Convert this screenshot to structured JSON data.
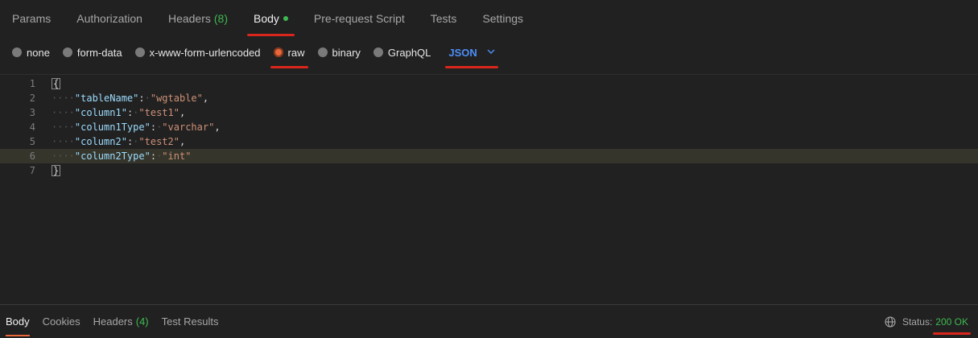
{
  "request_tabs": {
    "params": "Params",
    "authorization": "Authorization",
    "headers": "Headers",
    "headers_count": "(8)",
    "body": "Body",
    "pre_request": "Pre-request Script",
    "tests": "Tests",
    "settings": "Settings"
  },
  "body_options": {
    "none": "none",
    "form_data": "form-data",
    "urlencoded": "x-www-form-urlencoded",
    "raw": "raw",
    "binary": "binary",
    "graphql": "GraphQL",
    "selected": "raw",
    "language": "JSON"
  },
  "editor": {
    "line_numbers": [
      "1",
      "2",
      "3",
      "4",
      "5",
      "6",
      "7"
    ],
    "open_brace": "{",
    "close_brace": "}",
    "lines": [
      {
        "key": "\"tableName\"",
        "value": "\"wgtable\"",
        "comma": ","
      },
      {
        "key": "\"column1\"",
        "value": "\"test1\"",
        "comma": ","
      },
      {
        "key": "\"column1Type\"",
        "value": "\"varchar\"",
        "comma": ","
      },
      {
        "key": "\"column2\"",
        "value": "\"test2\"",
        "comma": ","
      },
      {
        "key": "\"column2Type\"",
        "value": "\"int\"",
        "comma": ""
      }
    ],
    "current_line": 6
  },
  "response": {
    "body": "Body",
    "cookies": "Cookies",
    "headers": "Headers",
    "headers_count": "(4)",
    "test_results": "Test Results",
    "status_label": "Status:",
    "status_value": "200 OK"
  },
  "colors": {
    "accent_green": "#3fb950",
    "accent_blue": "#4d8ef7",
    "radio_selected": "#e8683a",
    "annotation_red": "#d9261c"
  }
}
